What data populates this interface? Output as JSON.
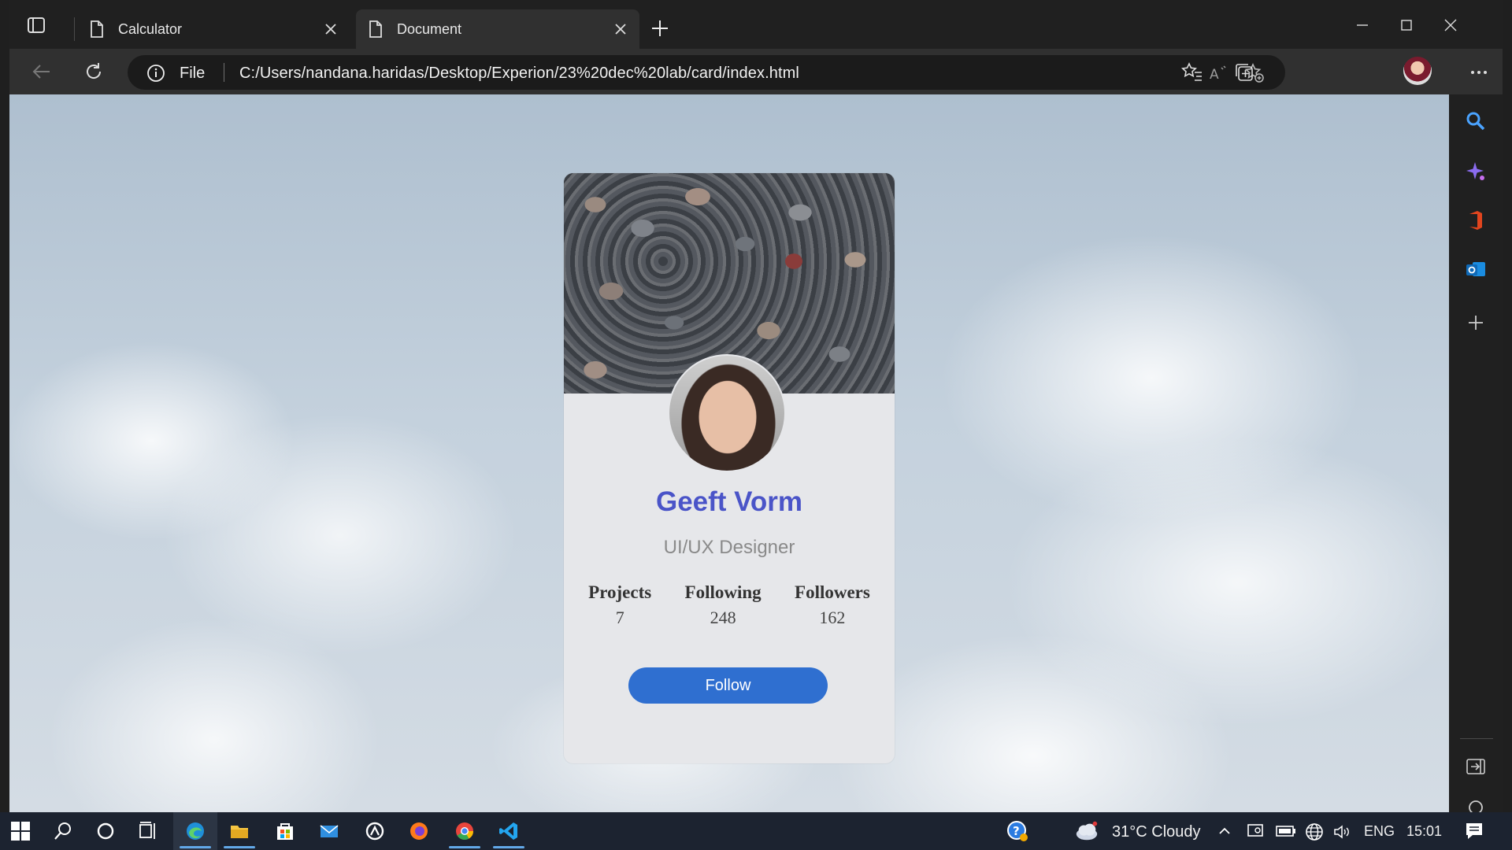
{
  "browser": {
    "tabs": [
      {
        "title": "Calculator",
        "active": false
      },
      {
        "title": "Document",
        "active": true
      }
    ],
    "address": {
      "scheme_label": "File",
      "url": "C:/Users/nandana.haridas/Desktop/Experion/23%20dec%20lab/card/index.html"
    }
  },
  "card": {
    "name": "Geeft Vorm",
    "role": "UI/UX Designer",
    "stats": [
      {
        "label": "Projects",
        "value": "7"
      },
      {
        "label": "Following",
        "value": "248"
      },
      {
        "label": "Followers",
        "value": "162"
      }
    ],
    "button_label": "Follow",
    "colors": {
      "name": "#4a54c8",
      "button": "#2f6fd0",
      "role": "#8a8a8a"
    }
  },
  "taskbar": {
    "weather": "31°C  Cloudy",
    "language": "ENG",
    "time": "15:01"
  },
  "icons": {
    "sidebar": [
      "search-icon",
      "copilot-icon",
      "office-icon",
      "outlook-icon",
      "add-icon",
      "split-screen-icon",
      "settings-icon"
    ],
    "taskbar_apps": [
      "start-icon",
      "search-icon",
      "cortana-icon",
      "task-view-icon",
      "edge-icon",
      "file-explorer-icon",
      "store-icon",
      "mail-icon",
      "app-icon",
      "firefox-icon",
      "chrome-icon",
      "vscode-icon"
    ]
  }
}
